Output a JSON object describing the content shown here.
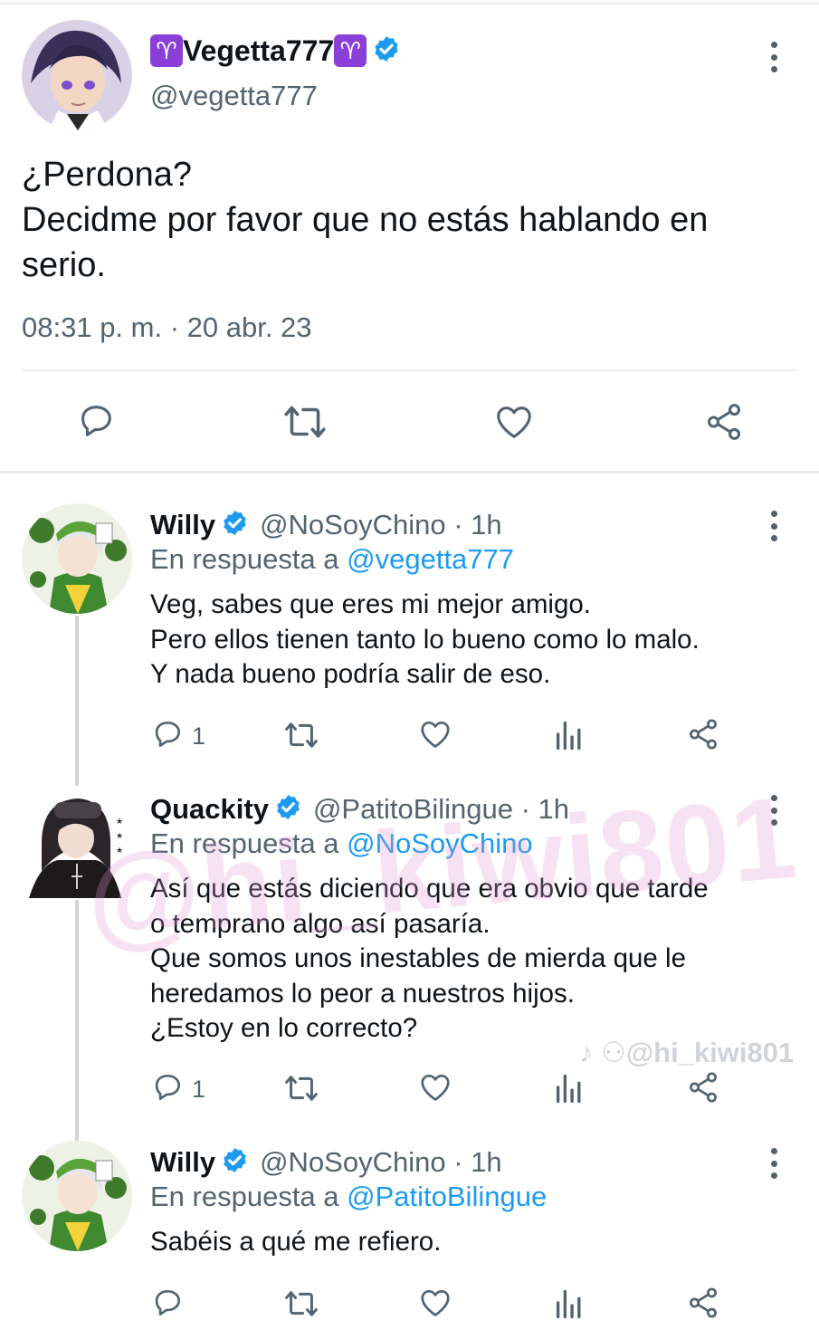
{
  "main_tweet": {
    "display_name": "Vegetta777",
    "name_emoji": "♈",
    "handle": "@vegetta777",
    "text_lines": [
      "¿Perdona?",
      "Decidme por favor que no estás hablando en",
      "serio."
    ],
    "timestamp": "08:31 p. m. · 20 abr. 23",
    "actions": [
      "reply-icon",
      "retweet-icon",
      "like-icon",
      "share-icon"
    ]
  },
  "replies": [
    {
      "display_name": "Willy",
      "handle_time": "@NoSoyChino · 1h",
      "in_reply_prefix": "En respuesta a ",
      "in_reply_to": "@vegetta777",
      "lines": [
        "Veg, sabes que eres mi mejor amigo.",
        "Pero ellos tienen tanto lo bueno como lo malo.",
        "Y nada bueno podría salir de eso."
      ],
      "reply_count": "1"
    },
    {
      "display_name": "Quackity",
      "handle_time": "@PatitoBilingue · 1h",
      "in_reply_prefix": "En respuesta a ",
      "in_reply_to": "@NoSoyChino",
      "lines": [
        "Así que estás diciendo que era obvio que tarde",
        "o temprano algo así pasaría.",
        "Que somos unos inestables de mierda que le",
        "heredamos lo peor a nuestros hijos.",
        "¿Estoy en lo correcto?"
      ],
      "reply_count": "1"
    },
    {
      "display_name": "Willy",
      "handle_time": "@NoSoyChino · 1h",
      "in_reply_prefix": "En respuesta a ",
      "in_reply_to": "@PatitoBilingue",
      "lines": [
        "Sabéis a qué me refiero."
      ],
      "reply_count": ""
    }
  ],
  "watermarks": {
    "large": "@hi_kiwi801",
    "small": "♪ ⚇@hi_kiwi801"
  },
  "colors": {
    "verified": "#1d9bf0",
    "mention": "#1d9bf0",
    "secondary_text": "#536471",
    "aries_badge": "#8b3fd9"
  }
}
